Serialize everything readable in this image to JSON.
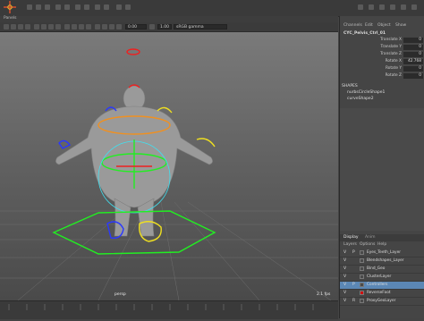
{
  "topbar": {
    "logo": "maya-logo-icon"
  },
  "panels": {
    "label": "Panels"
  },
  "viewport_toolbar": {
    "field1": "0.00",
    "field2": "1.00",
    "colorspace": "sRGB gamma"
  },
  "viewport": {
    "camera": "persp",
    "fps": "2.1 fps"
  },
  "channel_box": {
    "menu": [
      "Channels",
      "Edit",
      "Object",
      "Show"
    ],
    "object": "CYC_Pelvis_Ctrl_01",
    "attrs": [
      {
        "label": "Translate X",
        "value": "0"
      },
      {
        "label": "Translate Y",
        "value": "0"
      },
      {
        "label": "Translate Z",
        "value": "0"
      },
      {
        "label": "Rotate X",
        "value": "42.768"
      },
      {
        "label": "Rotate Y",
        "value": "0"
      },
      {
        "label": "Rotate Z",
        "value": "0"
      }
    ],
    "shapes_header": "SHAPES",
    "shapes": [
      "nurbsCircleShape1",
      "curveShape2"
    ]
  },
  "layers": {
    "tabs": [
      "Display",
      "Anim"
    ],
    "menu": [
      "Layers",
      "Options",
      "Help"
    ],
    "rows": [
      {
        "v": "V",
        "p": "P",
        "name": "Eyes_Teeth_Layer",
        "color": "#4a4a4a"
      },
      {
        "v": "V",
        "p": "",
        "name": "Blendshapes_Layer",
        "color": "#4a4a4a"
      },
      {
        "v": "V",
        "p": "",
        "name": "Bind_Geo",
        "color": "#4a4a4a"
      },
      {
        "v": "V",
        "p": "",
        "name": "ClusterLayer",
        "color": "#4a4a4a"
      },
      {
        "v": "V",
        "p": "P",
        "name": "Controllers",
        "color": "#4a4a4a"
      },
      {
        "v": "V",
        "p": "",
        "name": "ReverseFoot",
        "color": "#d01010"
      },
      {
        "v": "V",
        "p": "R",
        "name": "ProxyGeoLayer",
        "color": "#4a4a4a"
      }
    ]
  },
  "colors": {
    "green_ctrl": "#22ee22",
    "yellow_ctrl": "#f0e020",
    "blue_ctrl": "#2a38ff",
    "red_ctrl": "#ee2020",
    "cyan_ctrl": "#40e0f0",
    "orange_ctrl": "#f09020",
    "selected_layer": "#5b87b5"
  }
}
